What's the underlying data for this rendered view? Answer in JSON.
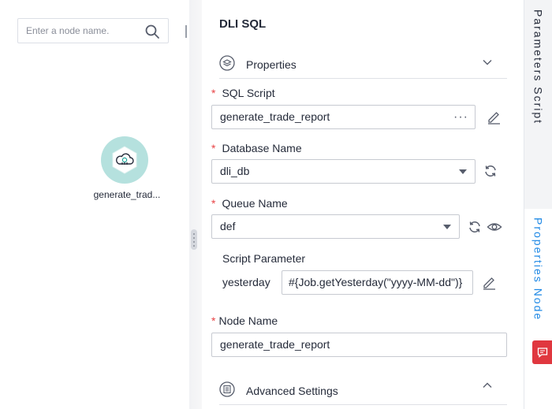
{
  "canvas": {
    "search": {
      "placeholder": "Enter a node name."
    },
    "node": {
      "label": "generate_trad..."
    }
  },
  "panel": {
    "title": "DLI SQL",
    "properties_section": {
      "label": "Properties"
    },
    "sql_script": {
      "label": "SQL Script",
      "value": "generate_trade_report",
      "more": "···"
    },
    "database_name": {
      "label": "Database Name",
      "value": "dli_db"
    },
    "queue_name": {
      "label": "Queue Name",
      "value": "def"
    },
    "script_parameter": {
      "label": "Script Parameter",
      "key": "yesterday",
      "value": "#{Job.getYesterday(\"yyyy-MM-dd\")}"
    },
    "node_name": {
      "label": "Node Name",
      "value": "generate_trade_report"
    },
    "advanced_section": {
      "label": "Advanced Settings"
    },
    "required_mark": "*"
  },
  "side_tabs": {
    "script_tab": "Parameters Script",
    "properties_tab": "Properties Node"
  },
  "colors": {
    "accent": "#1e88e5",
    "required": "#e84345",
    "node_bg": "#b5e1de",
    "feedback": "#e0373f"
  }
}
